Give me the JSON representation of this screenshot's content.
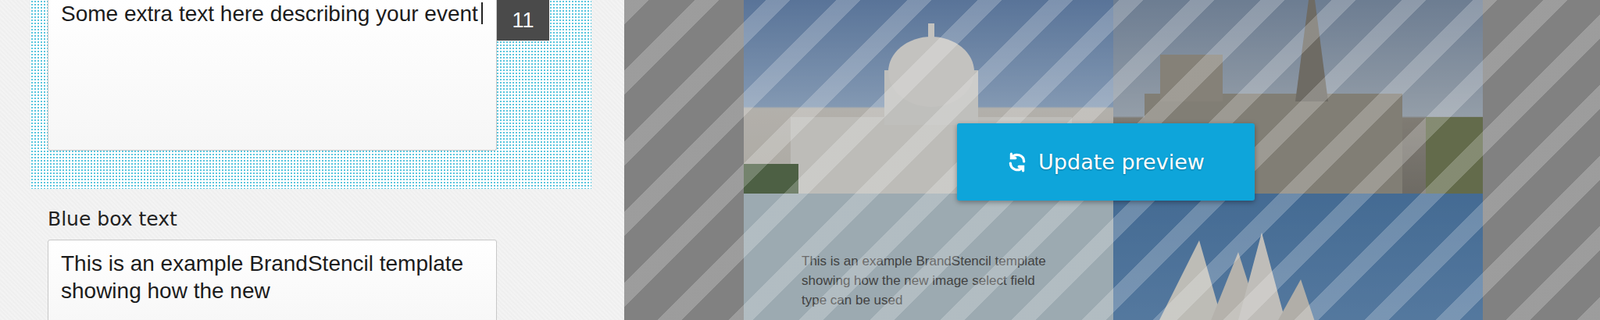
{
  "editor": {
    "event_field": {
      "value": "Some extra text here describing your event",
      "counter": "11",
      "focused": true
    },
    "blue_box_field": {
      "label": "Blue box text",
      "value": "This is an example BrandStencil template showing how the new"
    }
  },
  "preview": {
    "button": "Update preview",
    "blue_box_text": "This is an example BrandStencil template showing how the new image select field type can be used"
  }
}
